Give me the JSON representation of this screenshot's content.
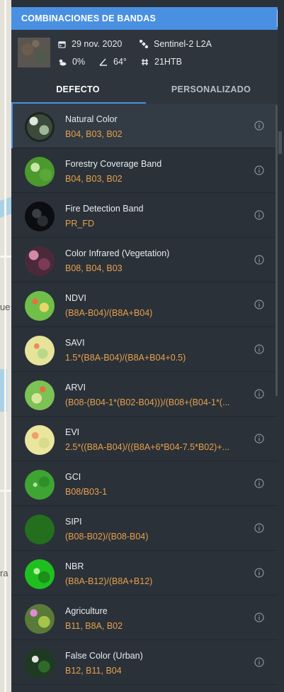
{
  "header": {
    "title": "COMBINACIONES DE BANDAS"
  },
  "meta": {
    "date": "29 nov. 2020",
    "satellite": "Sentinel-2 L2A",
    "cloud": "0%",
    "angle": "64°",
    "tile": "21HTB"
  },
  "tabs": {
    "default": "DEFECTO",
    "custom": "PERSONALIZADO"
  },
  "map_labels": [
    "ue",
    "ra"
  ],
  "accent": "#4a90e2",
  "formula_color": "#e8a04a",
  "bands": [
    {
      "name": "Natural Color",
      "formula": "B04, B03, B02",
      "thumb": "natural",
      "selected": true
    },
    {
      "name": "Forestry Coverage Band",
      "formula": "B04, B03, B02",
      "thumb": "forestry"
    },
    {
      "name": "Fire Detection Band",
      "formula": "PR_FD",
      "thumb": "fire"
    },
    {
      "name": "Color Infrared (Vegetation)",
      "formula": "B08, B04, B03",
      "thumb": "infrared"
    },
    {
      "name": "NDVI",
      "formula": "(B8A-B04)/(B8A+B04)",
      "thumb": "ndvi"
    },
    {
      "name": "SAVI",
      "formula": "1.5*(B8A-B04)/(B8A+B04+0.5)",
      "thumb": "savi"
    },
    {
      "name": "ARVI",
      "formula": "(B08-(B04-1*(B02-B04)))/(B08+(B04-1*(...",
      "thumb": "arvi"
    },
    {
      "name": "EVI",
      "formula": "2.5*((B8A-B04)/((B8A+6*B04-7.5*B02)+...",
      "thumb": "evi"
    },
    {
      "name": "GCI",
      "formula": "B08/B03-1",
      "thumb": "gci"
    },
    {
      "name": "SIPI",
      "formula": "(B08-B02)/(B08-B04)",
      "thumb": "sipi"
    },
    {
      "name": "NBR",
      "formula": "(B8A-B12)/(B8A+B12)",
      "thumb": "nbr"
    },
    {
      "name": "Agriculture",
      "formula": "B11, B8A, B02",
      "thumb": "agriculture"
    },
    {
      "name": "False Color (Urban)",
      "formula": "B12, B11, B04",
      "thumb": "urban"
    }
  ]
}
